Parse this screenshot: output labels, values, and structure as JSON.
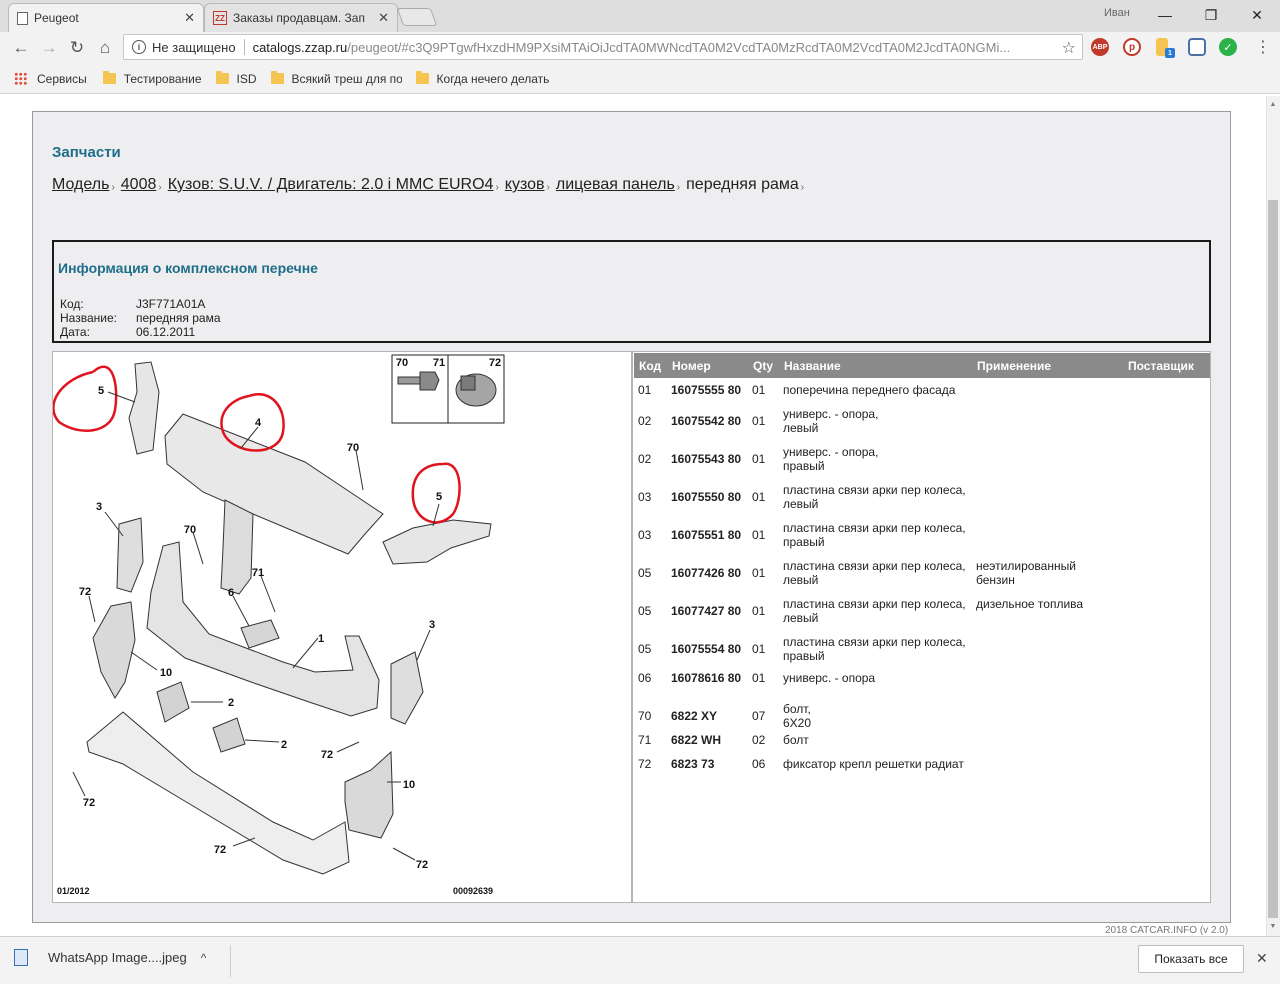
{
  "browser": {
    "tabs": [
      {
        "title": "Peugeot",
        "close": "✕"
      },
      {
        "title": "Заказы продавцам. Зап",
        "close": "✕"
      }
    ],
    "user": "Иван",
    "window_controls": {
      "minimize": "—",
      "maximize": "❐",
      "close": "✕"
    },
    "address": {
      "security": "Не защищено",
      "host": "catalogs.zzap.ru",
      "path": "/peugeot/#c3Q9PTgwfHxzdHM9PXsiMTAiOiJcdTA0MWNcdTA0M2VcdTA0MzRcdTA0M2VcdTA0M2JcdTA0NGMi..."
    },
    "bookmarks": [
      "Сервисы",
      "Тестирование",
      "ISD",
      "Всякий треш для пои",
      "Когда нечего делать"
    ],
    "extensions": [
      "ABP"
    ]
  },
  "page": {
    "section_title": "Запчасти",
    "breadcrumb": [
      {
        "label": "Модель",
        "link": true
      },
      {
        "label": "4008",
        "link": true
      },
      {
        "label": "Кузов: S.U.V. / Двигатель: 2.0 i MMC EURO4",
        "link": true
      },
      {
        "label": "кузов",
        "link": true
      },
      {
        "label": "лицевая панель",
        "link": true
      },
      {
        "label": "передняя рама",
        "link": false
      }
    ],
    "info": {
      "title": "Информация о комплексном перечне",
      "rows": [
        {
          "label": "Код:",
          "value": "J3F771A01A"
        },
        {
          "label": "Название:",
          "value": "передняя рама"
        },
        {
          "label": "Дата:",
          "value": "06.12.2011"
        }
      ]
    },
    "diagram": {
      "callouts": [
        "5",
        "4",
        "70",
        "5",
        "3",
        "70",
        "71",
        "6",
        "72",
        "1",
        "3",
        "10",
        "2",
        "2",
        "72",
        "10",
        "72",
        "72",
        "72"
      ],
      "inset_labels": [
        "70",
        "71",
        "72"
      ],
      "date_code": "01/2012",
      "image_code": "00092639"
    },
    "table": {
      "headers": [
        "Код",
        "Номер",
        "Qty",
        "Название",
        "Применение",
        "Поставщик"
      ],
      "rows": [
        {
          "code": "01",
          "number": "16075555 80",
          "qty": "01",
          "name": [
            "поперечина переднего фасада"
          ],
          "usage": [],
          "supplier": ""
        },
        {
          "code": "02",
          "number": "16075542 80",
          "qty": "01",
          "name": [
            "универс. - опора,",
            "левый"
          ],
          "usage": [],
          "supplier": ""
        },
        {
          "code": "02",
          "number": "16075543 80",
          "qty": "01",
          "name": [
            "универс. - опора,",
            "правый"
          ],
          "usage": [],
          "supplier": ""
        },
        {
          "code": "03",
          "number": "16075550 80",
          "qty": "01",
          "name": [
            "пластина связи арки пер колеса,",
            "левый"
          ],
          "usage": [],
          "supplier": ""
        },
        {
          "code": "03",
          "number": "16075551 80",
          "qty": "01",
          "name": [
            "пластина связи арки пер колеса,",
            "правый"
          ],
          "usage": [],
          "supplier": ""
        },
        {
          "code": "05",
          "number": "16077426 80",
          "qty": "01",
          "name": [
            "пластина связи арки пер колеса,",
            "левый"
          ],
          "usage": [
            "неэтилированный",
            "бензин"
          ],
          "supplier": ""
        },
        {
          "code": "05",
          "number": "16077427 80",
          "qty": "01",
          "name": [
            "пластина связи арки пер колеса,",
            "левый"
          ],
          "usage": [
            "дизельное топлива"
          ],
          "supplier": ""
        },
        {
          "code": "05",
          "number": "16075554 80",
          "qty": "01",
          "name": [
            "пластина связи арки пер колеса,",
            "правый"
          ],
          "usage": [],
          "supplier": ""
        },
        {
          "code": "06",
          "number": "16078616 80",
          "qty": "01",
          "name": [
            "универс. - опора"
          ],
          "usage": [],
          "supplier": ""
        },
        {
          "code": "70",
          "number": "6822 XY",
          "qty": "07",
          "name": [
            "болт,",
            "6X20"
          ],
          "usage": [],
          "supplier": ""
        },
        {
          "code": "71",
          "number": "6822 WH",
          "qty": "02",
          "name": [
            "болт"
          ],
          "usage": [],
          "supplier": ""
        },
        {
          "code": "72",
          "number": "6823 73",
          "qty": "06",
          "name": [
            "фиксатор крепл решетки радиат"
          ],
          "usage": [],
          "supplier": ""
        }
      ]
    },
    "footer_note": "2018 CATCAR.INFO (v 2.0)"
  },
  "downloads": {
    "file": "WhatsApp Image....jpeg",
    "show_all": "Показать все"
  },
  "colors": {
    "title_blue": "#1e6e8a",
    "header_gray": "#8a8a8a",
    "panel_bg": "#eeeef0",
    "annotation_red": "#e0141e"
  }
}
